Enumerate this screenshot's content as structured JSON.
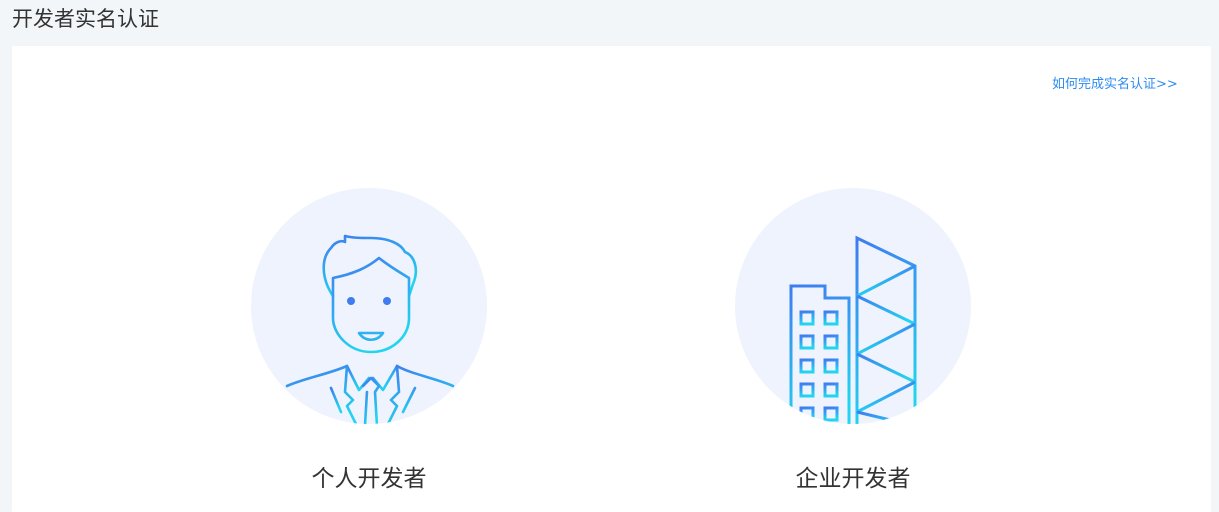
{
  "page": {
    "title": "开发者实名认证"
  },
  "help": {
    "link_text": "如何完成实名认证>>"
  },
  "options": [
    {
      "label": "个人开发者",
      "icon": "person-icon"
    },
    {
      "label": "企业开发者",
      "icon": "building-icon"
    }
  ],
  "colors": {
    "accent": "#2d8cf0",
    "circle": "#eef3fd",
    "gradient_start": "#3f7cf0",
    "gradient_end": "#22d4ef"
  }
}
